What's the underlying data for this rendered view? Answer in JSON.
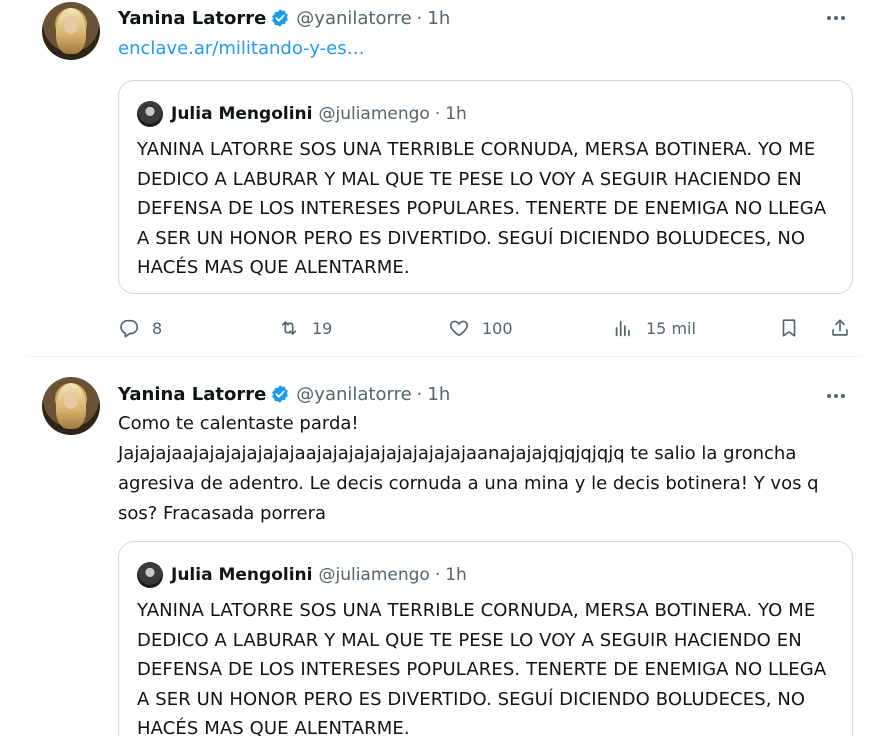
{
  "tweets": [
    {
      "author": {
        "name": "Yanina Latorre",
        "handle": "@yanilatorre",
        "time": "1h",
        "verified": true
      },
      "link_text": "enclave.ar/militando-y-es…",
      "quote": {
        "author": {
          "name": "Julia Mengolini",
          "handle": "@juliamengo",
          "time": "1h"
        },
        "text": "YANINA LATORRE SOS UNA TERRIBLE CORNUDA, MERSA BOTINERA. YO ME DEDICO A LABURAR Y MAL QUE TE PESE LO VOY A SEGUIR HACIENDO EN DEFENSA DE LOS INTERESES POPULARES. TENERTE DE ENEMIGA NO LLEGA A SER UN HONOR PERO ES DIVERTIDO. SEGUÍ DICIENDO BOLUDECES, NO HACÉS MAS QUE ALENTARME."
      },
      "actions": {
        "replies": "8",
        "retweets": "19",
        "likes": "100",
        "views": "15 mil"
      }
    },
    {
      "author": {
        "name": "Yanina Latorre",
        "handle": "@yanilatorre",
        "time": "1h",
        "verified": true
      },
      "text": "Como te calentaste parda! Jajajajaajajajajajajajaajajajajajajajajajajaanajajajqjqjqjqjq te salio la groncha agresiva de adentro. Le decis cornuda a una mina y le decis botinera! Y vos q sos? Fracasada porrera",
      "quote": {
        "author": {
          "name": "Julia Mengolini",
          "handle": "@juliamengo",
          "time": "1h"
        },
        "text": "YANINA LATORRE SOS UNA TERRIBLE CORNUDA, MERSA BOTINERA. YO ME DEDICO A LABURAR Y MAL QUE TE PESE LO VOY A SEGUIR HACIENDO EN DEFENSA DE LOS INTERESES POPULARES. TENERTE DE ENEMIGA NO LLEGA A SER UN HONOR PERO ES DIVERTIDO. SEGUÍ DICIENDO BOLUDECES, NO HACÉS MAS QUE ALENTARME."
      }
    }
  ],
  "separator": "·",
  "colors": {
    "link": "#1d9bf0",
    "verified": "#1d9bf0",
    "secondary_text": "#536471",
    "border": "#cfd9de"
  },
  "icons": [
    "more-icon",
    "verified-badge-icon",
    "reply-icon",
    "retweet-icon",
    "like-icon",
    "views-icon",
    "bookmark-icon",
    "share-icon"
  ]
}
